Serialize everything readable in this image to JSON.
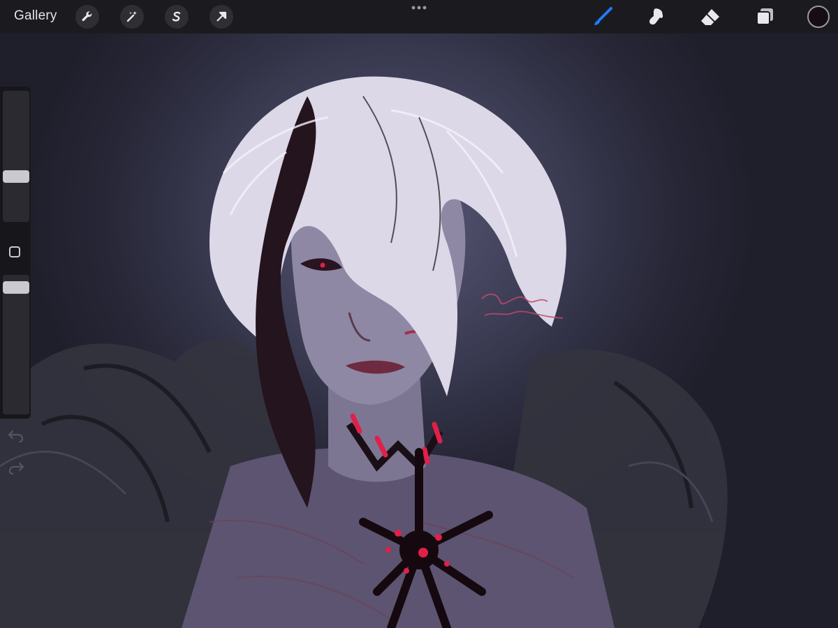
{
  "toolbar": {
    "gallery_label": "Gallery",
    "left_tools": [
      "wrench-icon",
      "magic-wand-icon",
      "selection-s-icon",
      "transform-arrow-icon"
    ],
    "more_menu": "more-dots-icon",
    "right_tools": [
      "brush-icon",
      "smudge-icon",
      "eraser-icon",
      "layers-icon"
    ],
    "active_tool": "brush-icon",
    "active_color": "#150d12",
    "accent_color": "#1e7bff"
  },
  "sidebar": {
    "brush_size_level": 0.33,
    "opacity_level": 0.95,
    "modify_button": "square-modify-icon",
    "undo": "undo-arrow-icon",
    "redo": "redo-arrow-icon"
  },
  "canvas": {
    "background_color": "#2a2a3c",
    "hair_color": "#e4e0ee",
    "accent_red": "#e0204a",
    "signature": "signature"
  }
}
